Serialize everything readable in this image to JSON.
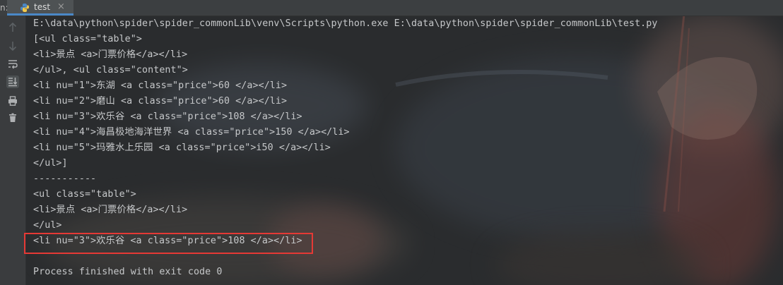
{
  "tabbar": {
    "prefix": "n:",
    "tab_label": "test",
    "close_glyph": "×"
  },
  "gutter": {
    "icons": [
      "arrow-up-icon",
      "arrow-down-icon",
      "soft-wrap-icon",
      "scroll-to-end-icon",
      "print-icon",
      "trash-icon"
    ]
  },
  "console": {
    "lines": [
      "E:\\data\\python\\spider\\spider_commonLib\\venv\\Scripts\\python.exe E:\\data\\python\\spider\\spider_commonLib\\test.py",
      "[<ul class=\"table\">",
      "<li>景点 <a>门票价格</a></li>",
      "</ul>, <ul class=\"content\">",
      "<li nu=\"1\">东湖 <a class=\"price\">60 </a></li>",
      "<li nu=\"2\">磨山 <a class=\"price\">60 </a></li>",
      "<li nu=\"3\">欢乐谷 <a class=\"price\">108 </a></li>",
      "<li nu=\"4\">海昌极地海洋世界 <a class=\"price\">150 </a></li>",
      "<li nu=\"5\">玛雅水上乐园 <a class=\"price\">i50 </a></li>",
      "</ul>]",
      "-----------",
      "<ul class=\"table\">",
      "<li>景点 <a>门票价格</a></li>",
      "</ul>",
      "<li nu=\"3\">欢乐谷 <a class=\"price\">108 </a></li>",
      "",
      "Process finished with exit code 0"
    ]
  },
  "colors": {
    "console_bg": "#2a2c2e",
    "text": "#c6c8ca",
    "highlight": "#e53935",
    "tab_accent": "#4a88c7"
  }
}
